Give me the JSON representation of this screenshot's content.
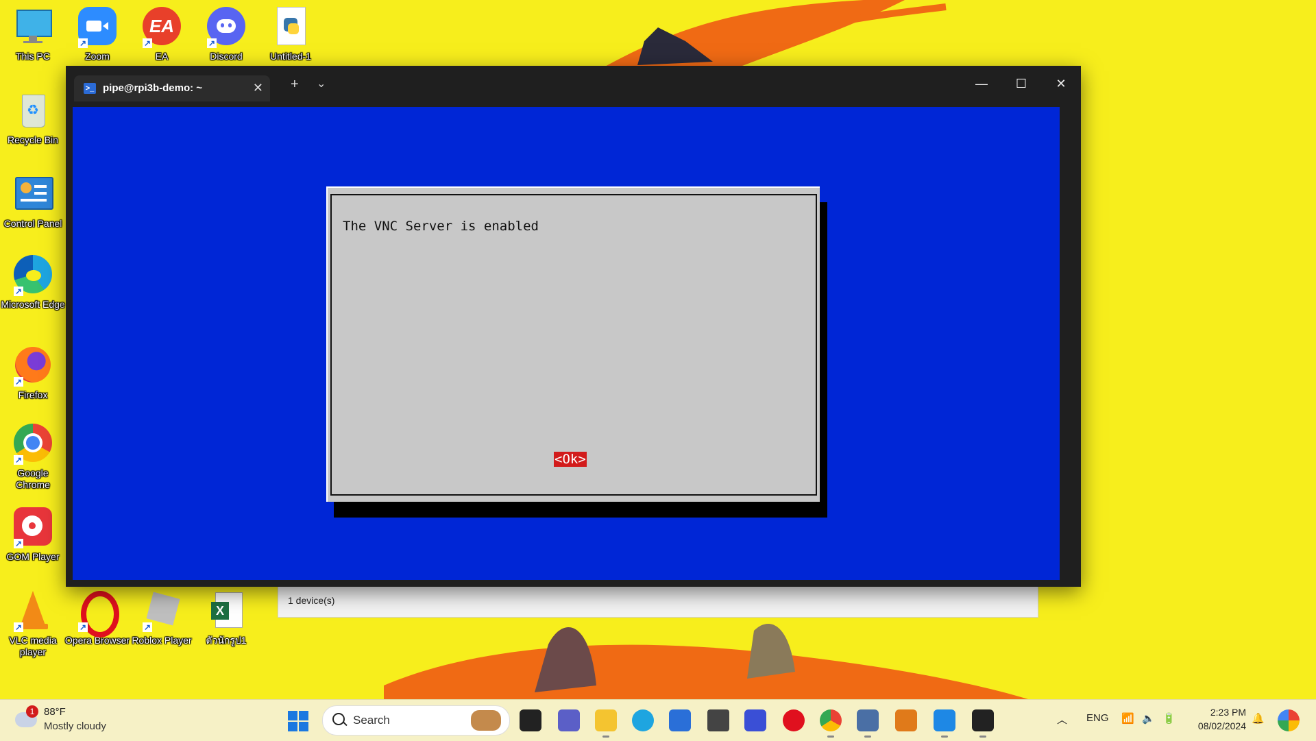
{
  "desktop": {
    "icons": [
      {
        "label": "This PC"
      },
      {
        "label": "Zoom"
      },
      {
        "label": "EA"
      },
      {
        "label": "Discord"
      },
      {
        "label": "Untitled-1"
      },
      {
        "label": "Recycle Bin"
      },
      {
        "label": "Control Panel"
      },
      {
        "label": "Microsoft Edge"
      },
      {
        "label": "Firefox"
      },
      {
        "label": "Google Chrome"
      },
      {
        "label": "GOM Player"
      },
      {
        "label": "VLC media player"
      },
      {
        "label": "Opera Browser"
      },
      {
        "label": "Roblox Player"
      },
      {
        "label": "ตัวนักรูป1"
      }
    ]
  },
  "background_window": {
    "status": "1 device(s)"
  },
  "terminal": {
    "tab_title": "pipe@rpi3b-demo: ~",
    "tab_close": "✕",
    "new_tab": "+",
    "dropdown": "⌄",
    "minimize": "—",
    "maximize": "☐",
    "close": "✕",
    "dialog": {
      "message": "The VNC Server is enabled",
      "ok_label": "<Ok>"
    },
    "colors": {
      "screen_bg": "#0026d6",
      "dialog_bg": "#c8c8c8",
      "ok_bg": "#d21b1b"
    }
  },
  "taskbar": {
    "weather": {
      "temp": "88°F",
      "desc": "Mostly cloudy",
      "badge": "1"
    },
    "search_placeholder": "Search",
    "language": "ENG",
    "time": "2:23 PM",
    "date": "08/02/2024"
  }
}
